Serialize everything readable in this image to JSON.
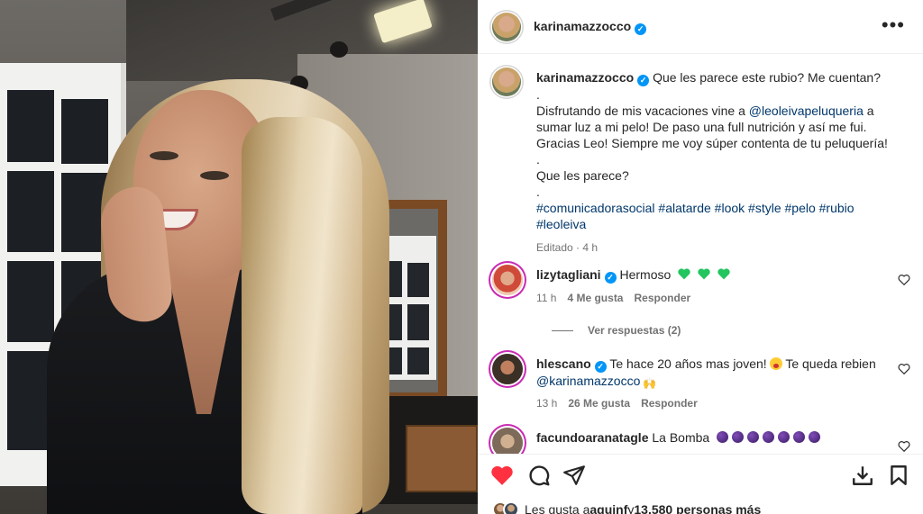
{
  "post": {
    "author": "karinamazzocco",
    "more_icon": "more-horizontal-icon"
  },
  "caption": {
    "author": "karinamazzocco",
    "first_line": "Que les parece este rubio? Me cuentan?",
    "dot1": ".",
    "line2_before": "Disfrutando de mis vacaciones vine a ",
    "mention": "@leoleivapeluqueria",
    "line2_after": " a",
    "line3": "sumar luz a mi pelo! De paso una full nutrición y así me fui.",
    "line4": "Gracias Leo! Siempre me voy súper contenta de tu peluquería!",
    "dot2": ".",
    "line5": "Que les parece?",
    "dot3": ".",
    "hashtags_line1": "#comunicadorasocial #alatarde #look #style #pelo #rubio",
    "hashtags_line2": "#leoleiva",
    "edited": "Editado",
    "edited_sep": "·",
    "time": "4 h"
  },
  "comments": [
    {
      "author": "lizytagliani",
      "text": "Hermoso",
      "emoji": "green-heart-icon",
      "time": "11 h",
      "likes": "4 Me gusta",
      "reply": "Responder",
      "view_replies": "Ver respuestas (2)"
    },
    {
      "author": "hlescano",
      "text_before": "Te hace 20 años mas joven!",
      "text_after": "Te queda rebien",
      "mention": "@karinamazzocco",
      "time": "13 h",
      "likes": "26 Me gusta",
      "reply": "Responder"
    },
    {
      "author": "facundoaranatagle",
      "text": "La Bomba",
      "emoji": "bomb-icon"
    }
  ],
  "footer": {
    "likes_prefix": "Les gusta a ",
    "likes_user": "aquinf",
    "likes_mid": " y ",
    "likes_count": "13.580 personas más"
  },
  "colors": {
    "like_red": "#ff3040",
    "link": "#00376b",
    "verified_blue": "#0095f6",
    "meta_gray": "#737373",
    "emoji_green": "#22c55e"
  }
}
